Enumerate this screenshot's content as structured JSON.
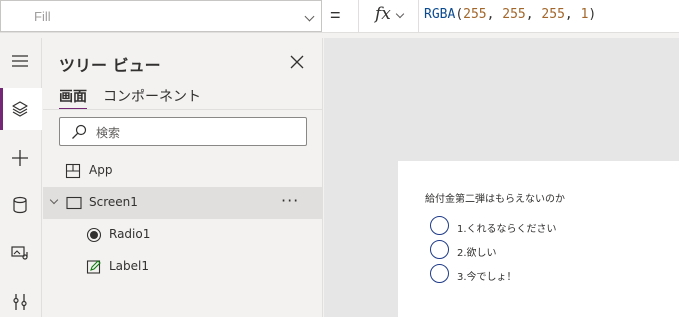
{
  "formula_bar": {
    "property": "Fill",
    "equals": "=",
    "fx_label": "fx",
    "formula": {
      "fn": "RGBA",
      "open": "(",
      "args": [
        "255",
        "255",
        "255",
        "1"
      ],
      "sep": ", ",
      "close": ")"
    }
  },
  "rail": {
    "items": [
      {
        "icon": "hamburger-icon"
      },
      {
        "icon": "layers-icon",
        "active": true
      },
      {
        "icon": "plus-icon"
      },
      {
        "icon": "database-icon"
      },
      {
        "icon": "media-icon"
      },
      {
        "icon": "tools-icon"
      }
    ]
  },
  "tree_view": {
    "title": "ツリー ビュー",
    "tabs": [
      "画面",
      "コンポーネント"
    ],
    "search_placeholder": "検索",
    "nodes": [
      {
        "label": "App",
        "icon": "app-icon"
      },
      {
        "label": "Screen1",
        "icon": "screen-icon",
        "selected": true,
        "more": "···"
      },
      {
        "label": "Radio1",
        "icon": "radio-icon"
      },
      {
        "label": "Label1",
        "icon": "label-icon"
      }
    ]
  },
  "canvas": {
    "question": "給付金第二弾はもらえないのか",
    "options": [
      "1.くれるならください",
      "2.欲しい",
      "3.今でしょ！"
    ],
    "colors": {
      "radio_border": "#1f3c88",
      "accent": "#742774"
    }
  }
}
